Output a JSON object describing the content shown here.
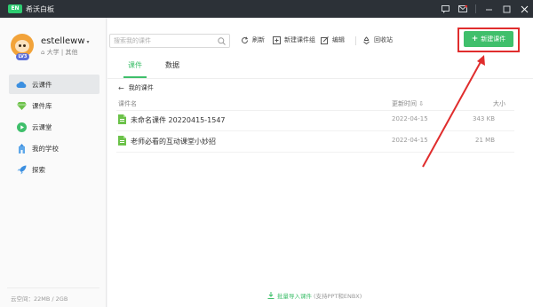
{
  "window": {
    "title": "希沃白板",
    "logo_text": "EN"
  },
  "titlebar_buttons": [
    {
      "name": "feedback-icon"
    },
    {
      "name": "mail-icon"
    },
    {
      "name": "minimize-icon"
    },
    {
      "name": "maximize-icon"
    },
    {
      "name": "close-icon"
    }
  ],
  "user": {
    "name": "estelleww",
    "level": "LV3",
    "meta": "大学 | 其他"
  },
  "sidebar": {
    "items": [
      {
        "label": "云课件",
        "icon": "cloud-icon",
        "active": true
      },
      {
        "label": "课件库",
        "icon": "gem-icon",
        "active": false
      },
      {
        "label": "云课堂",
        "icon": "play-circle-icon",
        "active": false
      },
      {
        "label": "我的学校",
        "icon": "school-icon",
        "active": false
      },
      {
        "label": "探索",
        "icon": "rocket-icon",
        "active": false
      }
    ],
    "storage": "云空间：22MB / 2GB"
  },
  "toolbar": {
    "search_placeholder": "搜索我的课件",
    "refresh": "刷新",
    "new_folder": "新建课件组",
    "edit": "编辑",
    "recycle": "回收站",
    "create": "新建课件"
  },
  "tabs": [
    {
      "label": "课件",
      "active": true
    },
    {
      "label": "数据",
      "active": false
    }
  ],
  "breadcrumb": "我的课件",
  "columns": {
    "name": "课件名",
    "updated": "更新时间 ⇩",
    "size": "大小"
  },
  "files": [
    {
      "name": "未命名课件 20220415-1547",
      "date": "2022-04-15",
      "size": "343 KB"
    },
    {
      "name": "老师必看的互动课堂小妙招",
      "date": "2022-04-15",
      "size": "21 MB"
    }
  ],
  "import": {
    "label": "批量导入课件",
    "hint": "(支持PPT和ENBX)"
  },
  "colors": {
    "accent": "#3fbf6b",
    "annotation": "#e02d2d",
    "titlebar": "#2c3137"
  }
}
